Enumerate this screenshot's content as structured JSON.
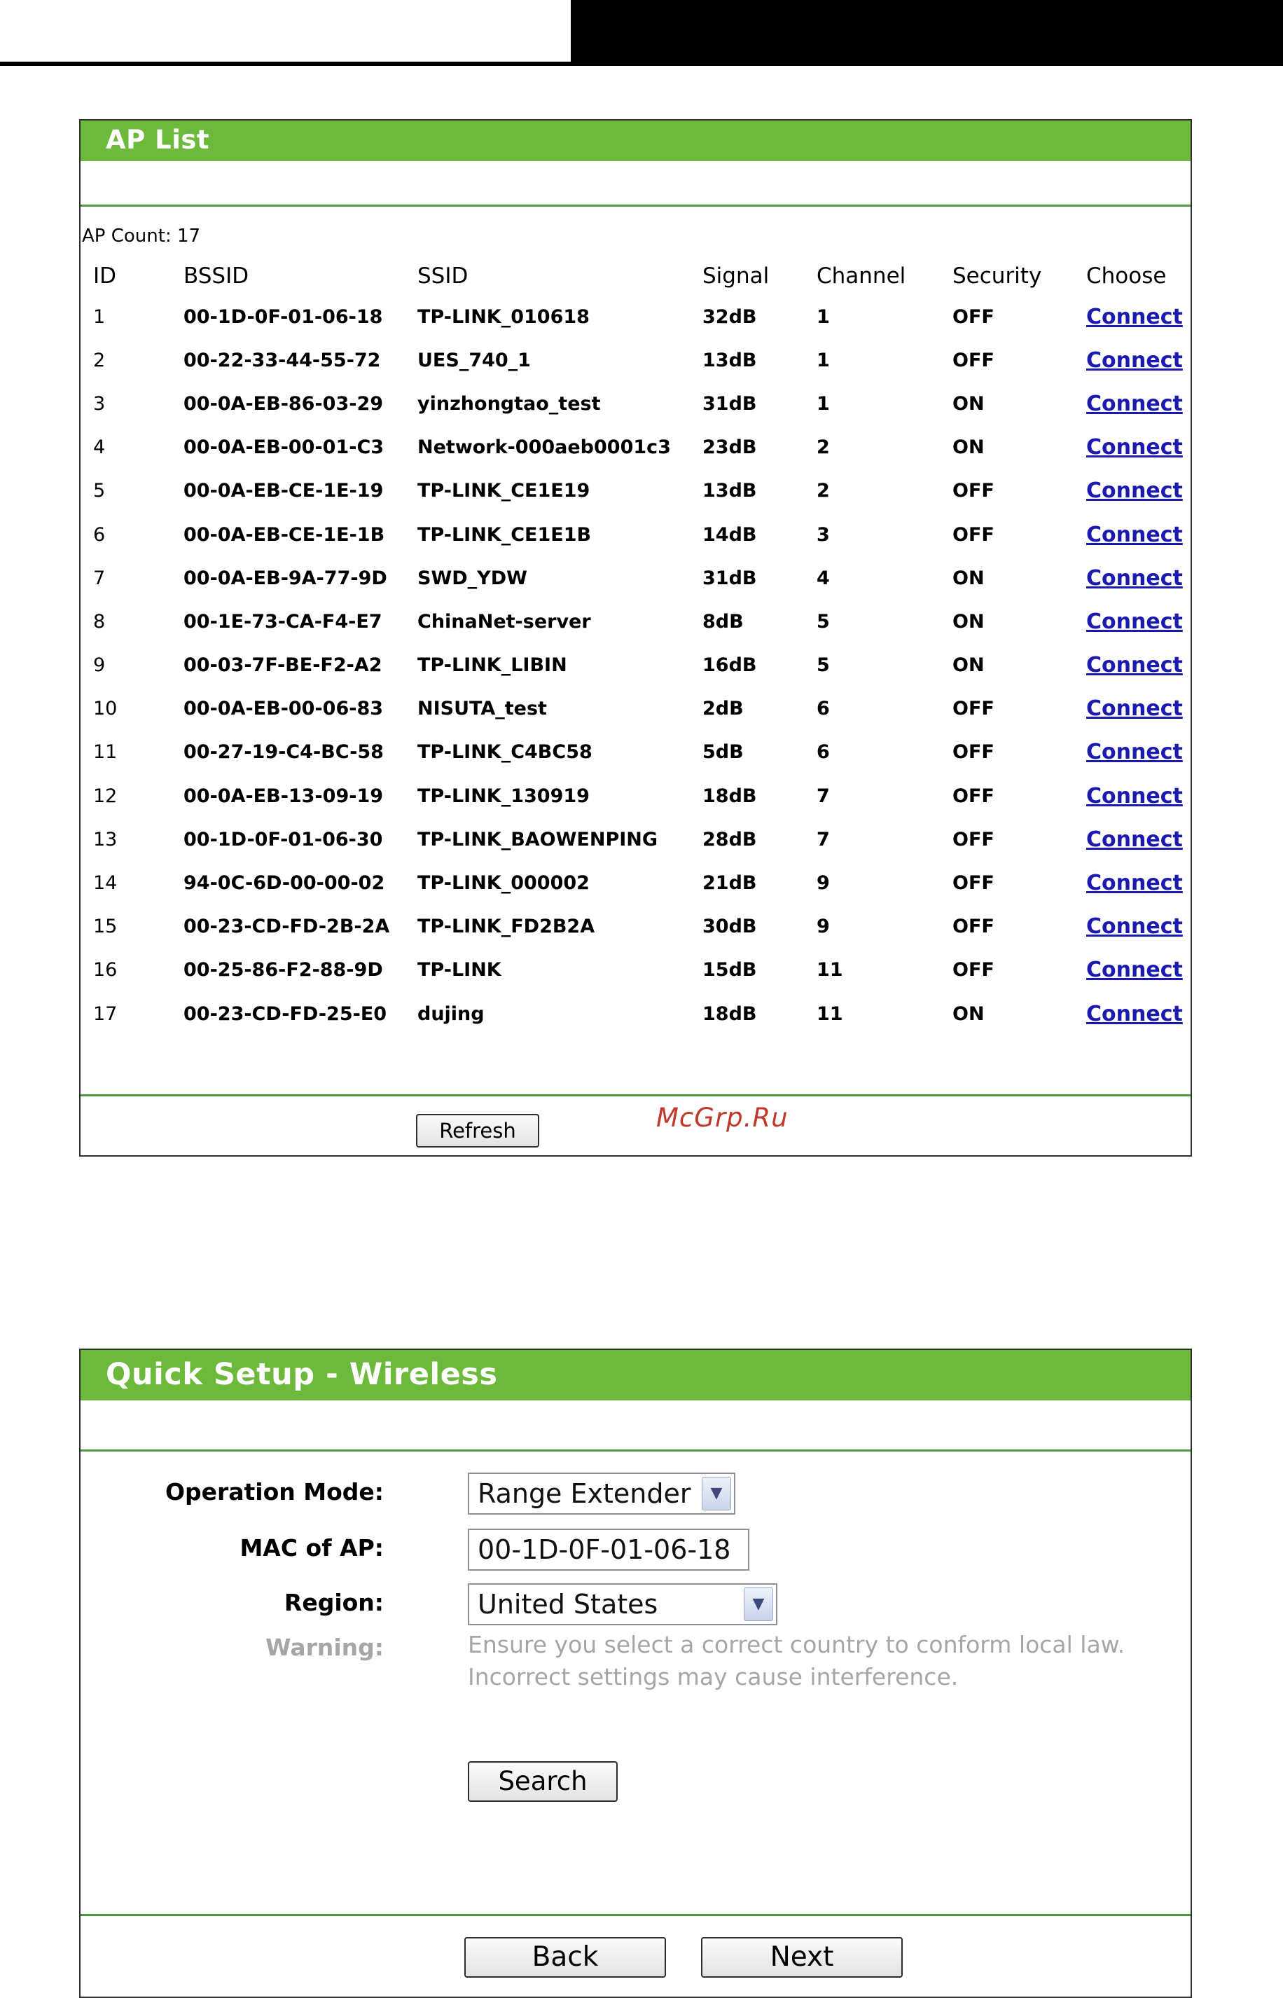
{
  "ap_list": {
    "title": "AP List",
    "count_label": "AP Count: 17",
    "columns": [
      "ID",
      "BSSID",
      "SSID",
      "Signal",
      "Channel",
      "Security",
      "Choose"
    ],
    "rows": [
      {
        "id": "1",
        "bssid": "00-1D-0F-01-06-18",
        "ssid": "TP-LINK_010618",
        "signal": "32dB",
        "channel": "1",
        "security": "OFF",
        "action": "Connect"
      },
      {
        "id": "2",
        "bssid": "00-22-33-44-55-72",
        "ssid": "UES_740_1",
        "signal": "13dB",
        "channel": "1",
        "security": "OFF",
        "action": "Connect"
      },
      {
        "id": "3",
        "bssid": "00-0A-EB-86-03-29",
        "ssid": "yinzhongtao_test",
        "signal": "31dB",
        "channel": "1",
        "security": "ON",
        "action": "Connect"
      },
      {
        "id": "4",
        "bssid": "00-0A-EB-00-01-C3",
        "ssid": "Network-000aeb0001c3",
        "signal": "23dB",
        "channel": "2",
        "security": "ON",
        "action": "Connect"
      },
      {
        "id": "5",
        "bssid": "00-0A-EB-CE-1E-19",
        "ssid": "TP-LINK_CE1E19",
        "signal": "13dB",
        "channel": "2",
        "security": "OFF",
        "action": "Connect"
      },
      {
        "id": "6",
        "bssid": "00-0A-EB-CE-1E-1B",
        "ssid": "TP-LINK_CE1E1B",
        "signal": "14dB",
        "channel": "3",
        "security": "OFF",
        "action": "Connect"
      },
      {
        "id": "7",
        "bssid": "00-0A-EB-9A-77-9D",
        "ssid": "SWD_YDW",
        "signal": "31dB",
        "channel": "4",
        "security": "ON",
        "action": "Connect"
      },
      {
        "id": "8",
        "bssid": "00-1E-73-CA-F4-E7",
        "ssid": "ChinaNet-server",
        "signal": "8dB",
        "channel": "5",
        "security": "ON",
        "action": "Connect"
      },
      {
        "id": "9",
        "bssid": "00-03-7F-BE-F2-A2",
        "ssid": "TP-LINK_LIBIN",
        "signal": "16dB",
        "channel": "5",
        "security": "ON",
        "action": "Connect"
      },
      {
        "id": "10",
        "bssid": "00-0A-EB-00-06-83",
        "ssid": "NISUTA_test",
        "signal": "2dB",
        "channel": "6",
        "security": "OFF",
        "action": "Connect"
      },
      {
        "id": "11",
        "bssid": "00-27-19-C4-BC-58",
        "ssid": "TP-LINK_C4BC58",
        "signal": "5dB",
        "channel": "6",
        "security": "OFF",
        "action": "Connect"
      },
      {
        "id": "12",
        "bssid": "00-0A-EB-13-09-19",
        "ssid": "TP-LINK_130919",
        "signal": "18dB",
        "channel": "7",
        "security": "OFF",
        "action": "Connect"
      },
      {
        "id": "13",
        "bssid": "00-1D-0F-01-06-30",
        "ssid": "TP-LINK_BAOWENPING",
        "signal": "28dB",
        "channel": "7",
        "security": "OFF",
        "action": "Connect"
      },
      {
        "id": "14",
        "bssid": "94-0C-6D-00-00-02",
        "ssid": "TP-LINK_000002",
        "signal": "21dB",
        "channel": "9",
        "security": "OFF",
        "action": "Connect"
      },
      {
        "id": "15",
        "bssid": "00-23-CD-FD-2B-2A",
        "ssid": "TP-LINK_FD2B2A",
        "signal": "30dB",
        "channel": "9",
        "security": "OFF",
        "action": "Connect"
      },
      {
        "id": "16",
        "bssid": "00-25-86-F2-88-9D",
        "ssid": "TP-LINK",
        "signal": "15dB",
        "channel": "11",
        "security": "OFF",
        "action": "Connect"
      },
      {
        "id": "17",
        "bssid": "00-23-CD-FD-25-E0",
        "ssid": "dujing",
        "signal": "18dB",
        "channel": "11",
        "security": "ON",
        "action": "Connect"
      }
    ],
    "refresh_label": "Refresh"
  },
  "watermark": "McGrp.Ru",
  "quick_setup": {
    "title": "Quick Setup - Wireless",
    "operation_mode_label": "Operation Mode:",
    "operation_mode_value": "Range Extender",
    "mac_label": "MAC of AP:",
    "mac_value": "00-1D-0F-01-06-18",
    "region_label": "Region:",
    "region_value": "United States",
    "warning_label": "Warning:",
    "warning_line1": "Ensure you select a correct country to conform local law.",
    "warning_line2": "Incorrect settings may cause interference.",
    "search_label": "Search",
    "back_label": "Back",
    "next_label": "Next"
  },
  "colors": {
    "header_green": "#6cb93c",
    "rule_green": "#4f9a3e",
    "link_blue": "#1a1ab0",
    "warning_gray": "#a6a6a6"
  }
}
